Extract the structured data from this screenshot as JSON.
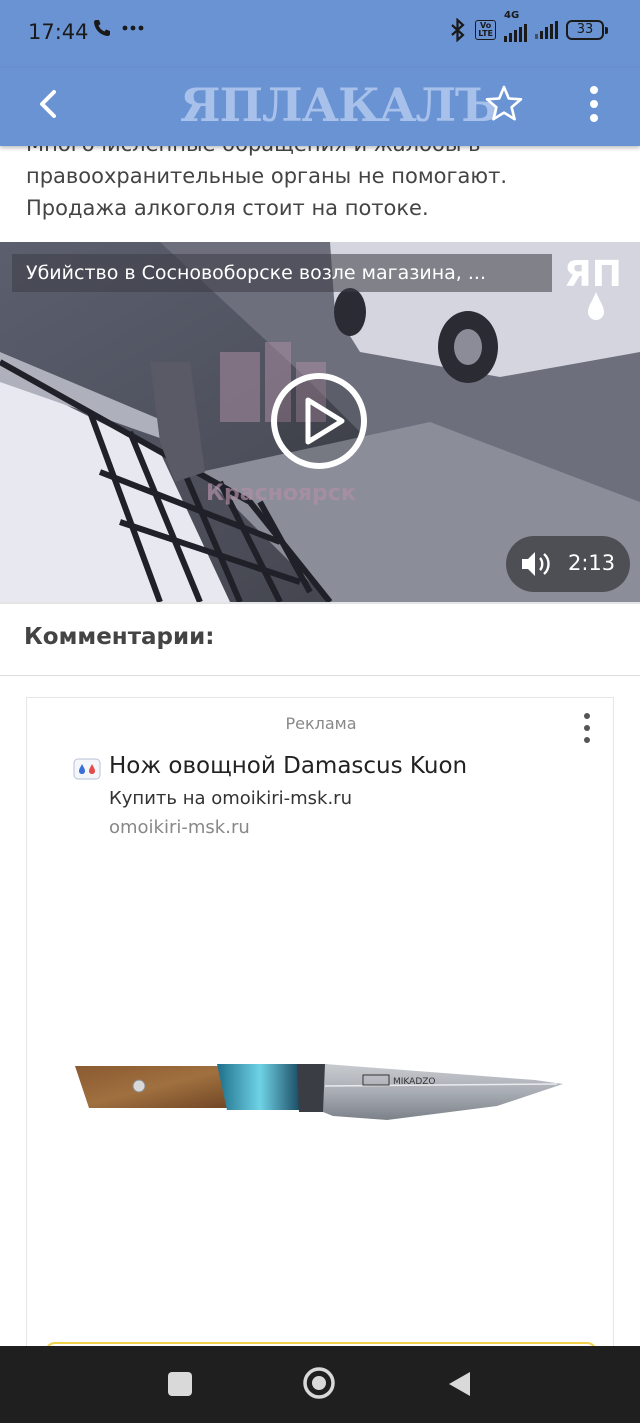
{
  "status": {
    "time": "17:44",
    "battery": "33"
  },
  "toolbar": {
    "logo": "ЯПЛАКАЛЪ"
  },
  "article": {
    "lines": [
      "Многочисленные обращения и жалобы в",
      "правоохранительные органы не помогают.",
      "Продажа алкоголя стоит на потоке."
    ]
  },
  "video": {
    "title": "Убийство в Сосновоборске возле магазина, ...",
    "duration": "2:13",
    "watermark": "ЧП Красноярск"
  },
  "comments": {
    "title": "Комментарии:"
  },
  "ad": {
    "label": "Реклама",
    "headline": "Нож овощной Damascus Kuon",
    "subline": "Купить на omoikiri-msk.ru",
    "domain": "omoikiri-msk.ru",
    "product_brand": "MIKADZO"
  },
  "colors": {
    "header": "#6a93d3",
    "navbar": "#1f1f1f",
    "cta_border": "#f2d24b"
  }
}
